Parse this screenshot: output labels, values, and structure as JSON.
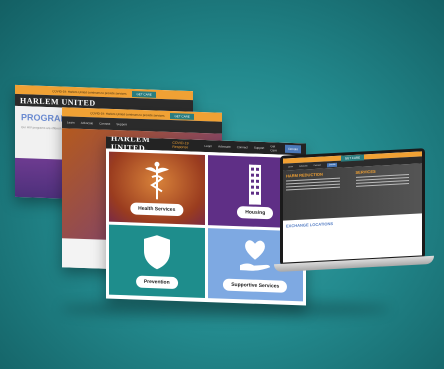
{
  "site": {
    "logo": "HARLEM UNITED",
    "promo_text": "COVID-19: Harlem United continues to provide services",
    "promo_button": "GET CARE",
    "nav_links": [
      "COVID-19 Response",
      "Learn",
      "Advocate",
      "Connect",
      "Support",
      "Get Care"
    ],
    "donate": "Donate"
  },
  "programs_window": {
    "heading": "PROGRAMS",
    "intro": "Our HIV programs are offered at our locations"
  },
  "middle_window": {
    "hero_fragment": "H"
  },
  "services_window": {
    "tiles": [
      {
        "label": "Health Services",
        "icon": "caduceus-icon",
        "color": "#c06a2c"
      },
      {
        "label": "Housing",
        "icon": "building-icon",
        "color": "#5f2f86"
      },
      {
        "label": "Prevention",
        "icon": "shield-icon",
        "color": "#1e8d8c"
      },
      {
        "label": "Supportive Services",
        "icon": "heart-hand-icon",
        "color": "#7ea9e2"
      }
    ]
  },
  "laptop_page": {
    "section1": "HARM REDUCTION",
    "section2": "SERVICES",
    "section3": "EXCHANGE LOCATIONS"
  },
  "colors": {
    "background": "#238a8e",
    "accent_orange": "#f0a134",
    "nav_dark": "#232323"
  }
}
